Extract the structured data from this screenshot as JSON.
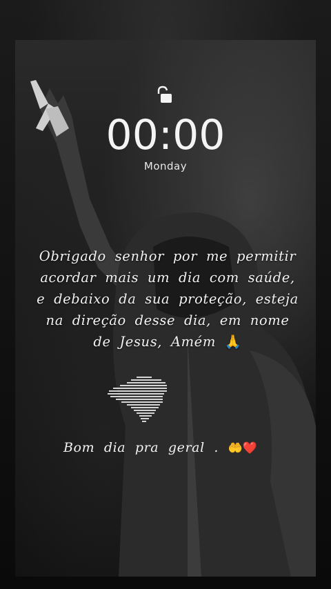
{
  "lockscreen": {
    "lock_icon": "unlocked-padlock-icon",
    "time": "00:00",
    "day": "Monday"
  },
  "message": {
    "lines": [
      "Obrigado senhor por me permitir",
      "acordar mais um dia com saúde,",
      "e debaixo da sua proteção, esteja",
      "na direção desse dia, em nome",
      "de Jesus, Amém"
    ],
    "pray_emoji": "🙏"
  },
  "greeting": {
    "text": "Bom dia pra geral .",
    "emojis": "🤲❤️"
  },
  "colors": {
    "text": "#f2f2f2",
    "background": "#141414"
  }
}
